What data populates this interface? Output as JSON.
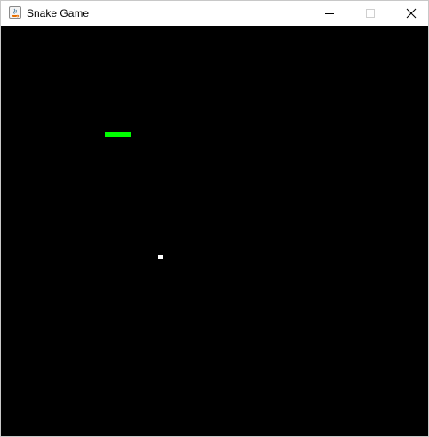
{
  "window": {
    "title": "Snake Game",
    "app_icon": "java-coffee-cup-icon",
    "controls": [
      "minimize-icon",
      "maximize-icon",
      "close-icon"
    ]
  },
  "game": {
    "background_color": "#000000",
    "snake_color": "#00ff00",
    "food_color": "#ffffff",
    "snake_segments": 5,
    "snake_direction": "horizontal"
  }
}
